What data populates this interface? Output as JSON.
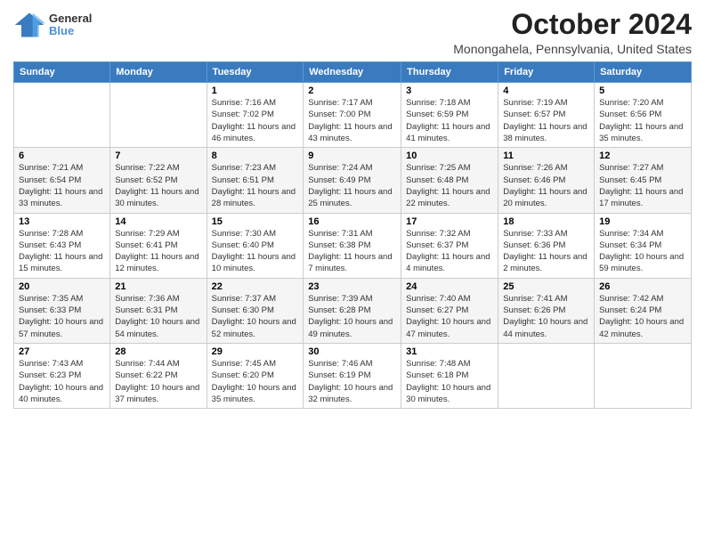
{
  "header": {
    "logo_line1": "General",
    "logo_line2": "Blue",
    "month": "October 2024",
    "location": "Monongahela, Pennsylvania, United States"
  },
  "days_of_week": [
    "Sunday",
    "Monday",
    "Tuesday",
    "Wednesday",
    "Thursday",
    "Friday",
    "Saturday"
  ],
  "weeks": [
    [
      {
        "day": "",
        "sunrise": "",
        "sunset": "",
        "daylight": ""
      },
      {
        "day": "",
        "sunrise": "",
        "sunset": "",
        "daylight": ""
      },
      {
        "day": "1",
        "sunrise": "Sunrise: 7:16 AM",
        "sunset": "Sunset: 7:02 PM",
        "daylight": "Daylight: 11 hours and 46 minutes."
      },
      {
        "day": "2",
        "sunrise": "Sunrise: 7:17 AM",
        "sunset": "Sunset: 7:00 PM",
        "daylight": "Daylight: 11 hours and 43 minutes."
      },
      {
        "day": "3",
        "sunrise": "Sunrise: 7:18 AM",
        "sunset": "Sunset: 6:59 PM",
        "daylight": "Daylight: 11 hours and 41 minutes."
      },
      {
        "day": "4",
        "sunrise": "Sunrise: 7:19 AM",
        "sunset": "Sunset: 6:57 PM",
        "daylight": "Daylight: 11 hours and 38 minutes."
      },
      {
        "day": "5",
        "sunrise": "Sunrise: 7:20 AM",
        "sunset": "Sunset: 6:56 PM",
        "daylight": "Daylight: 11 hours and 35 minutes."
      }
    ],
    [
      {
        "day": "6",
        "sunrise": "Sunrise: 7:21 AM",
        "sunset": "Sunset: 6:54 PM",
        "daylight": "Daylight: 11 hours and 33 minutes."
      },
      {
        "day": "7",
        "sunrise": "Sunrise: 7:22 AM",
        "sunset": "Sunset: 6:52 PM",
        "daylight": "Daylight: 11 hours and 30 minutes."
      },
      {
        "day": "8",
        "sunrise": "Sunrise: 7:23 AM",
        "sunset": "Sunset: 6:51 PM",
        "daylight": "Daylight: 11 hours and 28 minutes."
      },
      {
        "day": "9",
        "sunrise": "Sunrise: 7:24 AM",
        "sunset": "Sunset: 6:49 PM",
        "daylight": "Daylight: 11 hours and 25 minutes."
      },
      {
        "day": "10",
        "sunrise": "Sunrise: 7:25 AM",
        "sunset": "Sunset: 6:48 PM",
        "daylight": "Daylight: 11 hours and 22 minutes."
      },
      {
        "day": "11",
        "sunrise": "Sunrise: 7:26 AM",
        "sunset": "Sunset: 6:46 PM",
        "daylight": "Daylight: 11 hours and 20 minutes."
      },
      {
        "day": "12",
        "sunrise": "Sunrise: 7:27 AM",
        "sunset": "Sunset: 6:45 PM",
        "daylight": "Daylight: 11 hours and 17 minutes."
      }
    ],
    [
      {
        "day": "13",
        "sunrise": "Sunrise: 7:28 AM",
        "sunset": "Sunset: 6:43 PM",
        "daylight": "Daylight: 11 hours and 15 minutes."
      },
      {
        "day": "14",
        "sunrise": "Sunrise: 7:29 AM",
        "sunset": "Sunset: 6:41 PM",
        "daylight": "Daylight: 11 hours and 12 minutes."
      },
      {
        "day": "15",
        "sunrise": "Sunrise: 7:30 AM",
        "sunset": "Sunset: 6:40 PM",
        "daylight": "Daylight: 11 hours and 10 minutes."
      },
      {
        "day": "16",
        "sunrise": "Sunrise: 7:31 AM",
        "sunset": "Sunset: 6:38 PM",
        "daylight": "Daylight: 11 hours and 7 minutes."
      },
      {
        "day": "17",
        "sunrise": "Sunrise: 7:32 AM",
        "sunset": "Sunset: 6:37 PM",
        "daylight": "Daylight: 11 hours and 4 minutes."
      },
      {
        "day": "18",
        "sunrise": "Sunrise: 7:33 AM",
        "sunset": "Sunset: 6:36 PM",
        "daylight": "Daylight: 11 hours and 2 minutes."
      },
      {
        "day": "19",
        "sunrise": "Sunrise: 7:34 AM",
        "sunset": "Sunset: 6:34 PM",
        "daylight": "Daylight: 10 hours and 59 minutes."
      }
    ],
    [
      {
        "day": "20",
        "sunrise": "Sunrise: 7:35 AM",
        "sunset": "Sunset: 6:33 PM",
        "daylight": "Daylight: 10 hours and 57 minutes."
      },
      {
        "day": "21",
        "sunrise": "Sunrise: 7:36 AM",
        "sunset": "Sunset: 6:31 PM",
        "daylight": "Daylight: 10 hours and 54 minutes."
      },
      {
        "day": "22",
        "sunrise": "Sunrise: 7:37 AM",
        "sunset": "Sunset: 6:30 PM",
        "daylight": "Daylight: 10 hours and 52 minutes."
      },
      {
        "day": "23",
        "sunrise": "Sunrise: 7:39 AM",
        "sunset": "Sunset: 6:28 PM",
        "daylight": "Daylight: 10 hours and 49 minutes."
      },
      {
        "day": "24",
        "sunrise": "Sunrise: 7:40 AM",
        "sunset": "Sunset: 6:27 PM",
        "daylight": "Daylight: 10 hours and 47 minutes."
      },
      {
        "day": "25",
        "sunrise": "Sunrise: 7:41 AM",
        "sunset": "Sunset: 6:26 PM",
        "daylight": "Daylight: 10 hours and 44 minutes."
      },
      {
        "day": "26",
        "sunrise": "Sunrise: 7:42 AM",
        "sunset": "Sunset: 6:24 PM",
        "daylight": "Daylight: 10 hours and 42 minutes."
      }
    ],
    [
      {
        "day": "27",
        "sunrise": "Sunrise: 7:43 AM",
        "sunset": "Sunset: 6:23 PM",
        "daylight": "Daylight: 10 hours and 40 minutes."
      },
      {
        "day": "28",
        "sunrise": "Sunrise: 7:44 AM",
        "sunset": "Sunset: 6:22 PM",
        "daylight": "Daylight: 10 hours and 37 minutes."
      },
      {
        "day": "29",
        "sunrise": "Sunrise: 7:45 AM",
        "sunset": "Sunset: 6:20 PM",
        "daylight": "Daylight: 10 hours and 35 minutes."
      },
      {
        "day": "30",
        "sunrise": "Sunrise: 7:46 AM",
        "sunset": "Sunset: 6:19 PM",
        "daylight": "Daylight: 10 hours and 32 minutes."
      },
      {
        "day": "31",
        "sunrise": "Sunrise: 7:48 AM",
        "sunset": "Sunset: 6:18 PM",
        "daylight": "Daylight: 10 hours and 30 minutes."
      },
      {
        "day": "",
        "sunrise": "",
        "sunset": "",
        "daylight": ""
      },
      {
        "day": "",
        "sunrise": "",
        "sunset": "",
        "daylight": ""
      }
    ]
  ]
}
